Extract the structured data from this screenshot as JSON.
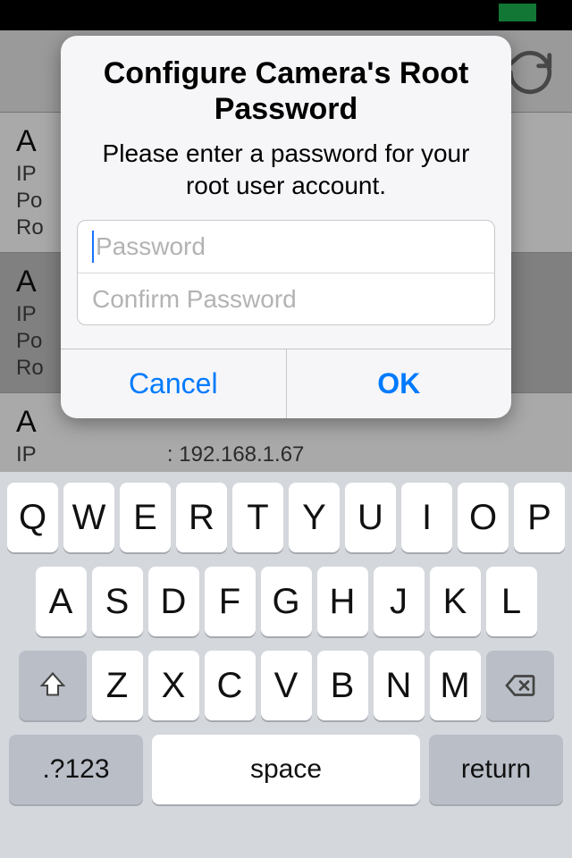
{
  "background": {
    "rows": [
      {
        "title": "A",
        "lines": [
          "IP",
          "Po",
          "Ro"
        ]
      },
      {
        "title": "A",
        "lines": [
          "IP",
          "Po",
          "Ro"
        ],
        "alt": true
      },
      {
        "title": "A",
        "ip_label": "IP",
        "ip_value": ": 192.168.1.67"
      }
    ]
  },
  "modal": {
    "title": "Configure Camera's Root Password",
    "message": "Please enter a password for your root user account.",
    "password_placeholder": "Password",
    "confirm_placeholder": "Confirm Password",
    "cancel": "Cancel",
    "ok": "OK"
  },
  "keyboard": {
    "row1": [
      "Q",
      "W",
      "E",
      "R",
      "T",
      "Y",
      "U",
      "I",
      "O",
      "P"
    ],
    "row2": [
      "A",
      "S",
      "D",
      "F",
      "G",
      "H",
      "J",
      "K",
      "L"
    ],
    "row3": [
      "Z",
      "X",
      "C",
      "V",
      "B",
      "N",
      "M"
    ],
    "mode": ".?123",
    "space": "space",
    "return": "return"
  }
}
